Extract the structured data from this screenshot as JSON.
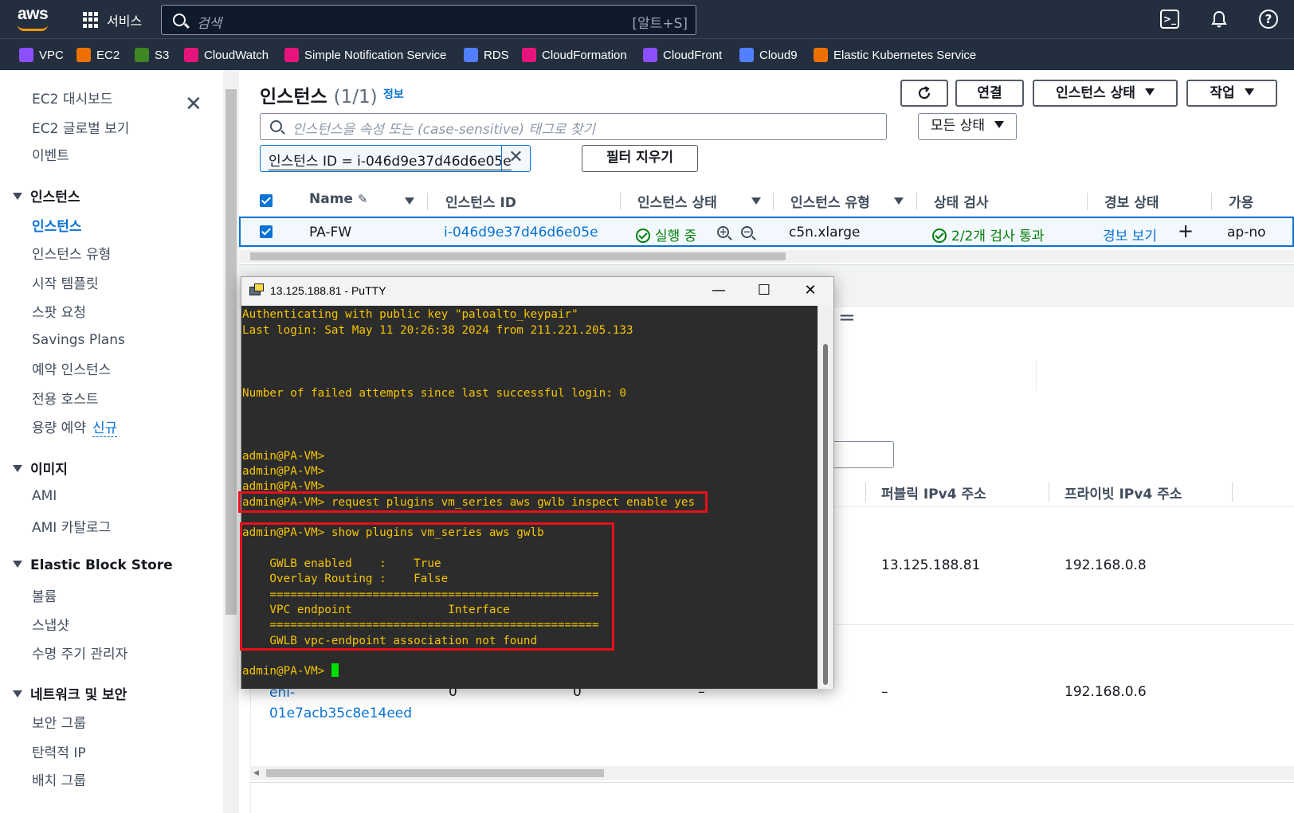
{
  "topbar": {
    "logo": "aws",
    "services_label": "서비스",
    "search_placeholder": "검색",
    "search_shortcut": "[알트+S]"
  },
  "favorites": [
    {
      "label": "VPC",
      "color": "#8c4fff"
    },
    {
      "label": "EC2",
      "color": "#ed7100"
    },
    {
      "label": "S3",
      "color": "#3f8624"
    },
    {
      "label": "CloudWatch",
      "color": "#e7157b"
    },
    {
      "label": "Simple Notification Service",
      "color": "#e7157b"
    },
    {
      "label": "RDS",
      "color": "#527fff"
    },
    {
      "label": "CloudFormation",
      "color": "#e7157b"
    },
    {
      "label": "CloudFront",
      "color": "#8c4fff"
    },
    {
      "label": "Cloud9",
      "color": "#527fff"
    },
    {
      "label": "Elastic Kubernetes Service",
      "color": "#ed7100"
    }
  ],
  "sidebar": {
    "items_top": [
      "EC2 대시보드",
      "EC2 글로벌 보기",
      "이벤트"
    ],
    "sections": {
      "instances": {
        "title": "인스턴스",
        "items": [
          "인스턴스",
          "인스턴스 유형",
          "시작 템플릿",
          "스팟 요청",
          "Savings Plans",
          "예약 인스턴스",
          "전용 호스트",
          "용량 예약"
        ],
        "new_badge": "신규"
      },
      "images": {
        "title": "이미지",
        "items": [
          "AMI",
          "AMI 카탈로그"
        ]
      },
      "ebs": {
        "title": "Elastic Block Store",
        "items": [
          "볼륨",
          "스냅샷",
          "수명 주기 관리자"
        ]
      },
      "network": {
        "title": "네트워크 및 보안",
        "items": [
          "보안 그룹",
          "탄력적 IP",
          "배치 그룹"
        ]
      }
    }
  },
  "main": {
    "title": "인스턴스",
    "count": "(1/1)",
    "info": "정보",
    "buttons": {
      "connect": "연결",
      "state": "인스턴스 상태",
      "actions": "작업"
    },
    "search_placeholder": "인스턴스을 속성 또는 (case-sensitive) 태그로 찾기",
    "all_states": "모든 상태",
    "filter_token": "인스턴스 ID = i-046d9e37d46d6e05e",
    "clear_filters": "필터 지우기",
    "columns": [
      "Name",
      "인스턴스 ID",
      "인스턴스 상태",
      "인스턴스 유형",
      "상태 검사",
      "경보 상태",
      "가용"
    ],
    "row": {
      "name": "PA-FW",
      "id": "i-046d9e37d46d6e05e",
      "state": "실행 중",
      "type": "c5n.xlarge",
      "check": "2/2개 검사 통과",
      "alarm": "경보 보기",
      "az": "ap-no"
    }
  },
  "network_interfaces": {
    "columns": [
      "퍼블릭 IPv4 주소",
      "프라이빗 IPv4 주소"
    ],
    "rows": [
      {
        "public_ip": "13.125.188.81",
        "private_ip": "192.168.0.8"
      },
      {
        "eni": "eni-01e7acb35c8e14eed",
        "eni_line1": "eni-",
        "eni_line2": "01e7acb35c8e14eed",
        "c1": "0",
        "c2": "0",
        "c3": "–",
        "public_ip": "–",
        "private_ip": "192.168.0.6"
      }
    ]
  },
  "putty": {
    "title": "13.125.188.81 - PuTTY",
    "lines": [
      "Authenticating with public key \"paloalto_keypair\"",
      "Last login: Sat May 11 20:26:38 2024 from 211.221.205.133",
      "",
      "",
      "",
      "Number of failed attempts since last successful login: 0",
      "",
      "",
      "",
      "admin@PA-VM>",
      "admin@PA-VM>",
      "admin@PA-VM>",
      "admin@PA-VM> request plugins vm_series aws gwlb inspect enable yes",
      "",
      "admin@PA-VM> show plugins vm_series aws gwlb",
      "",
      "    GWLB enabled    :    True",
      "    Overlay Routing :    False",
      "    ================================================",
      "    VPC endpoint              Interface",
      "    ================================================",
      "    GWLB vpc-endpoint association not found",
      "",
      "admin@PA-VM> "
    ]
  }
}
